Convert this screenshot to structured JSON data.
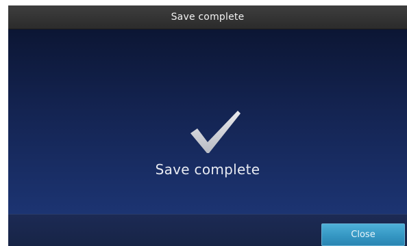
{
  "window": {
    "title": "Save complete"
  },
  "dialog": {
    "message": "Save complete",
    "icon": "checkmark-icon"
  },
  "footer": {
    "close_label": "Close"
  },
  "colors": {
    "accent": "#3597c3",
    "background_top": "#0c1634",
    "background_bottom": "#1c3472",
    "titlebar": "#2b2b2b"
  }
}
